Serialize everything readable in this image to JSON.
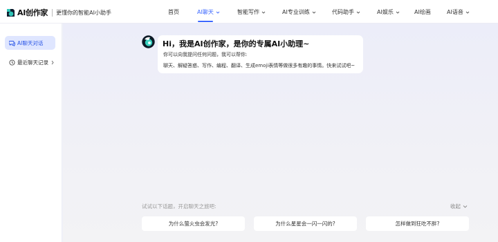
{
  "header": {
    "logo": {
      "name": "AI创作家",
      "slogan": "更懂你的智能AI小助手"
    },
    "nav": [
      {
        "label": "首页",
        "has_dropdown": false,
        "active": false
      },
      {
        "label": "AI聊天",
        "has_dropdown": true,
        "active": true
      },
      {
        "label": "智能写作",
        "has_dropdown": true,
        "active": false
      },
      {
        "label": "AI专业训练",
        "has_dropdown": true,
        "active": false
      },
      {
        "label": "代码助手",
        "has_dropdown": true,
        "active": false
      },
      {
        "label": "AI娱乐",
        "has_dropdown": true,
        "active": false
      },
      {
        "label": "AI绘画",
        "has_dropdown": false,
        "active": false
      },
      {
        "label": "AI语音",
        "has_dropdown": true,
        "active": false
      }
    ]
  },
  "sidebar": {
    "items": [
      {
        "label": "AI聊天对话",
        "icon": "chat-bubbles-icon",
        "active": true
      },
      {
        "label": "最近聊天记录",
        "icon": "clock-icon",
        "active": false
      }
    ]
  },
  "chat": {
    "greeting_title": "Hi，我是AI创作家，是你的专属AI小助理~",
    "greeting_sub": "你可以向我提问任何问题，我可以帮你:",
    "greeting_capabilities": "聊天、解疑答惑、写作、编程、翻译、生成emoji表情等做很多有趣的事情。快来试试吧~"
  },
  "topics": {
    "hint": "试试以下话题，开启聊天之旅吧:",
    "collapse_label": "收起",
    "items": [
      "为什么萤火虫会发光?",
      "为什么星星会一闪一闪的?",
      "怎样做到狂吃不胖?"
    ]
  },
  "colors": {
    "accent": "#3d68ff",
    "sidebar_active_bg": "#dfe6ff"
  }
}
